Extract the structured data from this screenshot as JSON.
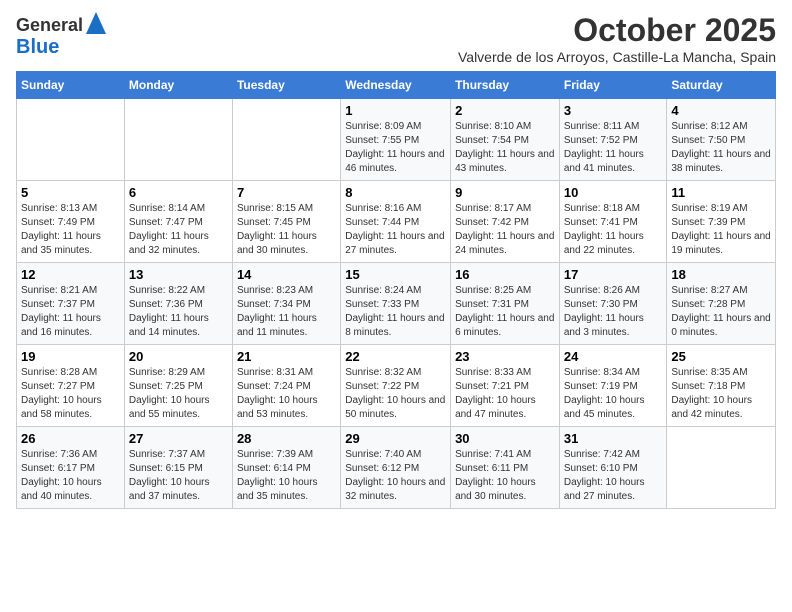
{
  "header": {
    "logo_line1": "General",
    "logo_line2": "Blue",
    "month": "October 2025",
    "location": "Valverde de los Arroyos, Castille-La Mancha, Spain"
  },
  "days_of_week": [
    "Sunday",
    "Monday",
    "Tuesday",
    "Wednesday",
    "Thursday",
    "Friday",
    "Saturday"
  ],
  "weeks": [
    [
      {
        "day": "",
        "info": ""
      },
      {
        "day": "",
        "info": ""
      },
      {
        "day": "",
        "info": ""
      },
      {
        "day": "1",
        "info": "Sunrise: 8:09 AM\nSunset: 7:55 PM\nDaylight: 11 hours and 46 minutes."
      },
      {
        "day": "2",
        "info": "Sunrise: 8:10 AM\nSunset: 7:54 PM\nDaylight: 11 hours and 43 minutes."
      },
      {
        "day": "3",
        "info": "Sunrise: 8:11 AM\nSunset: 7:52 PM\nDaylight: 11 hours and 41 minutes."
      },
      {
        "day": "4",
        "info": "Sunrise: 8:12 AM\nSunset: 7:50 PM\nDaylight: 11 hours and 38 minutes."
      }
    ],
    [
      {
        "day": "5",
        "info": "Sunrise: 8:13 AM\nSunset: 7:49 PM\nDaylight: 11 hours and 35 minutes."
      },
      {
        "day": "6",
        "info": "Sunrise: 8:14 AM\nSunset: 7:47 PM\nDaylight: 11 hours and 32 minutes."
      },
      {
        "day": "7",
        "info": "Sunrise: 8:15 AM\nSunset: 7:45 PM\nDaylight: 11 hours and 30 minutes."
      },
      {
        "day": "8",
        "info": "Sunrise: 8:16 AM\nSunset: 7:44 PM\nDaylight: 11 hours and 27 minutes."
      },
      {
        "day": "9",
        "info": "Sunrise: 8:17 AM\nSunset: 7:42 PM\nDaylight: 11 hours and 24 minutes."
      },
      {
        "day": "10",
        "info": "Sunrise: 8:18 AM\nSunset: 7:41 PM\nDaylight: 11 hours and 22 minutes."
      },
      {
        "day": "11",
        "info": "Sunrise: 8:19 AM\nSunset: 7:39 PM\nDaylight: 11 hours and 19 minutes."
      }
    ],
    [
      {
        "day": "12",
        "info": "Sunrise: 8:21 AM\nSunset: 7:37 PM\nDaylight: 11 hours and 16 minutes."
      },
      {
        "day": "13",
        "info": "Sunrise: 8:22 AM\nSunset: 7:36 PM\nDaylight: 11 hours and 14 minutes."
      },
      {
        "day": "14",
        "info": "Sunrise: 8:23 AM\nSunset: 7:34 PM\nDaylight: 11 hours and 11 minutes."
      },
      {
        "day": "15",
        "info": "Sunrise: 8:24 AM\nSunset: 7:33 PM\nDaylight: 11 hours and 8 minutes."
      },
      {
        "day": "16",
        "info": "Sunrise: 8:25 AM\nSunset: 7:31 PM\nDaylight: 11 hours and 6 minutes."
      },
      {
        "day": "17",
        "info": "Sunrise: 8:26 AM\nSunset: 7:30 PM\nDaylight: 11 hours and 3 minutes."
      },
      {
        "day": "18",
        "info": "Sunrise: 8:27 AM\nSunset: 7:28 PM\nDaylight: 11 hours and 0 minutes."
      }
    ],
    [
      {
        "day": "19",
        "info": "Sunrise: 8:28 AM\nSunset: 7:27 PM\nDaylight: 10 hours and 58 minutes."
      },
      {
        "day": "20",
        "info": "Sunrise: 8:29 AM\nSunset: 7:25 PM\nDaylight: 10 hours and 55 minutes."
      },
      {
        "day": "21",
        "info": "Sunrise: 8:31 AM\nSunset: 7:24 PM\nDaylight: 10 hours and 53 minutes."
      },
      {
        "day": "22",
        "info": "Sunrise: 8:32 AM\nSunset: 7:22 PM\nDaylight: 10 hours and 50 minutes."
      },
      {
        "day": "23",
        "info": "Sunrise: 8:33 AM\nSunset: 7:21 PM\nDaylight: 10 hours and 47 minutes."
      },
      {
        "day": "24",
        "info": "Sunrise: 8:34 AM\nSunset: 7:19 PM\nDaylight: 10 hours and 45 minutes."
      },
      {
        "day": "25",
        "info": "Sunrise: 8:35 AM\nSunset: 7:18 PM\nDaylight: 10 hours and 42 minutes."
      }
    ],
    [
      {
        "day": "26",
        "info": "Sunrise: 7:36 AM\nSunset: 6:17 PM\nDaylight: 10 hours and 40 minutes."
      },
      {
        "day": "27",
        "info": "Sunrise: 7:37 AM\nSunset: 6:15 PM\nDaylight: 10 hours and 37 minutes."
      },
      {
        "day": "28",
        "info": "Sunrise: 7:39 AM\nSunset: 6:14 PM\nDaylight: 10 hours and 35 minutes."
      },
      {
        "day": "29",
        "info": "Sunrise: 7:40 AM\nSunset: 6:12 PM\nDaylight: 10 hours and 32 minutes."
      },
      {
        "day": "30",
        "info": "Sunrise: 7:41 AM\nSunset: 6:11 PM\nDaylight: 10 hours and 30 minutes."
      },
      {
        "day": "31",
        "info": "Sunrise: 7:42 AM\nSunset: 6:10 PM\nDaylight: 10 hours and 27 minutes."
      },
      {
        "day": "",
        "info": ""
      }
    ]
  ]
}
